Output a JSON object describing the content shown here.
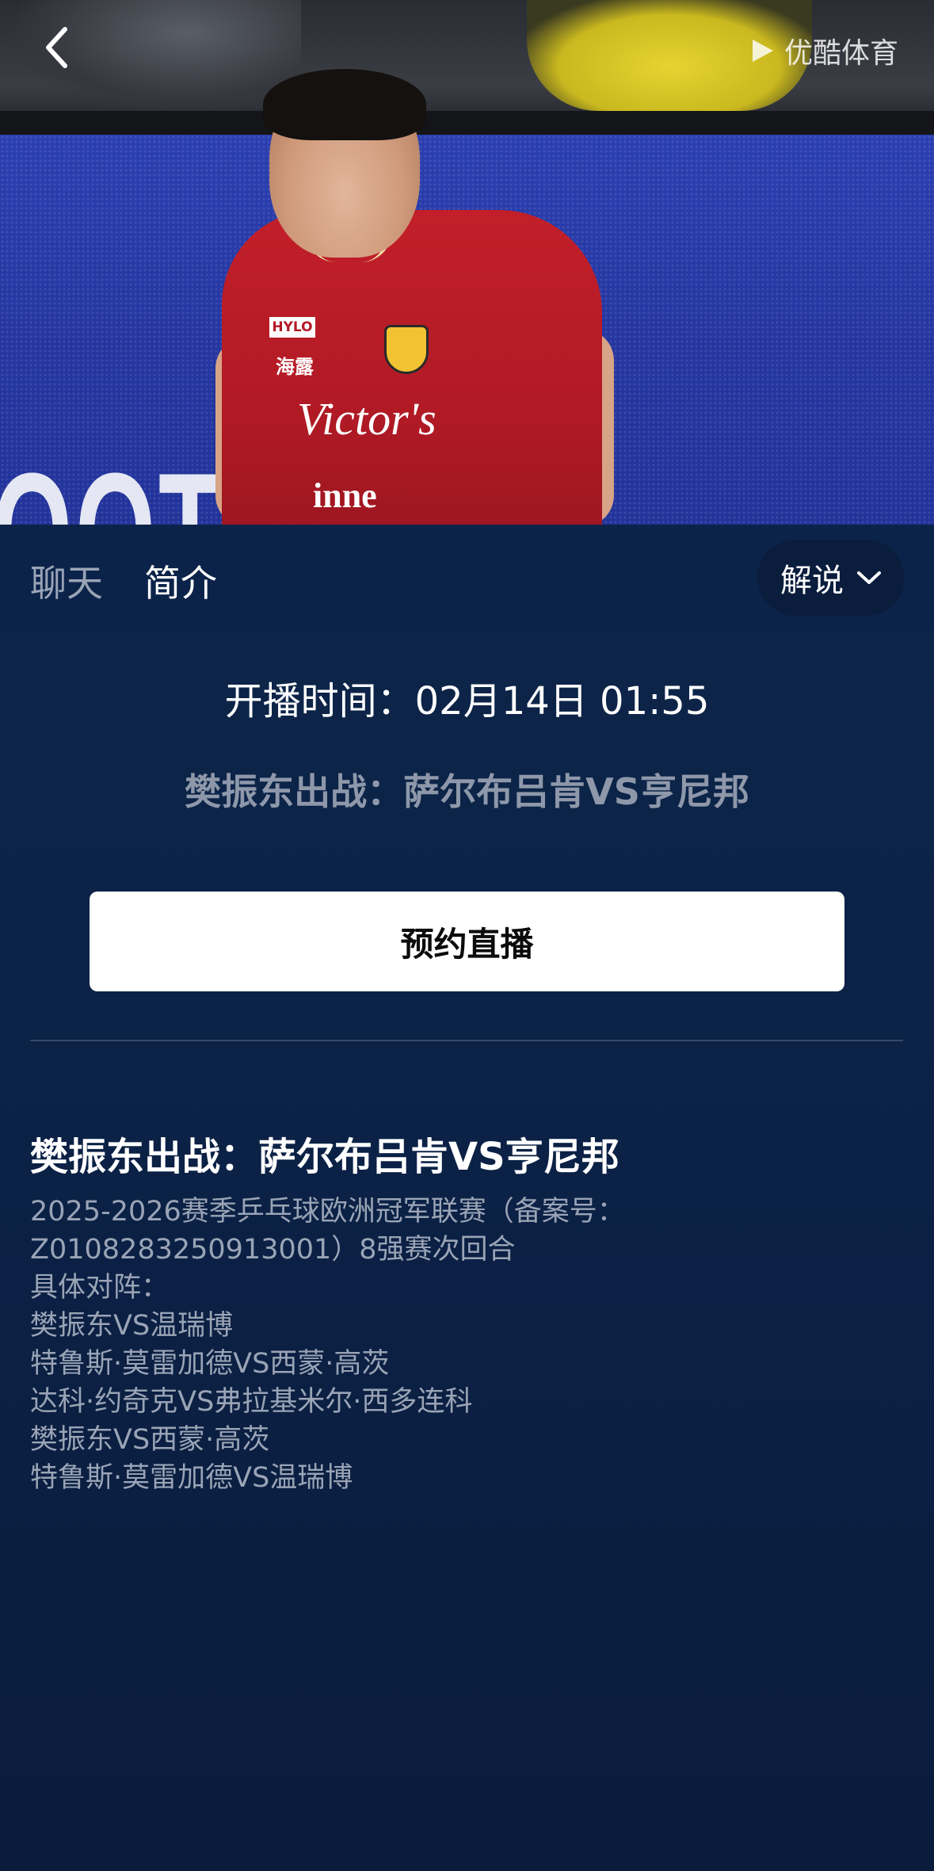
{
  "video": {
    "watermark": "优酷体育",
    "board_text": "OOT S",
    "jersey": {
      "sponsor_a": "HYLO",
      "sponsor_b": "海露",
      "sponsor_c": "Victor's",
      "sponsor_d": "inne"
    }
  },
  "tabs": [
    {
      "label": "聊天",
      "active": false
    },
    {
      "label": "简介",
      "active": true
    }
  ],
  "commentary": {
    "label": "解说"
  },
  "schedule": {
    "start_time": "开播时间：02月14日 01:55",
    "match_subtitle": "樊振东出战：萨尔布吕肯VS亨尼邦"
  },
  "reserve_button": {
    "label": "预约直播"
  },
  "description": {
    "title": "樊振东出战：萨尔布吕肯VS亨尼邦",
    "lines": [
      "2025-2026赛季乒乓球欧洲冠军联赛（备案号：",
      "Z0108283250913001）8强赛次回合",
      "具体对阵：",
      "樊振东VS温瑞博",
      "特鲁斯·莫雷加德VS西蒙·高茨",
      "达科·约奇克VS弗拉基米尔·西多连科",
      "樊振东VS西蒙·高茨",
      "特鲁斯·莫雷加德VS温瑞博"
    ]
  },
  "colors": {
    "background": "#0c2349",
    "muted_text": "#9aa4b6",
    "subtitle_text": "#8e98aa",
    "button_bg": "#ffffff"
  }
}
